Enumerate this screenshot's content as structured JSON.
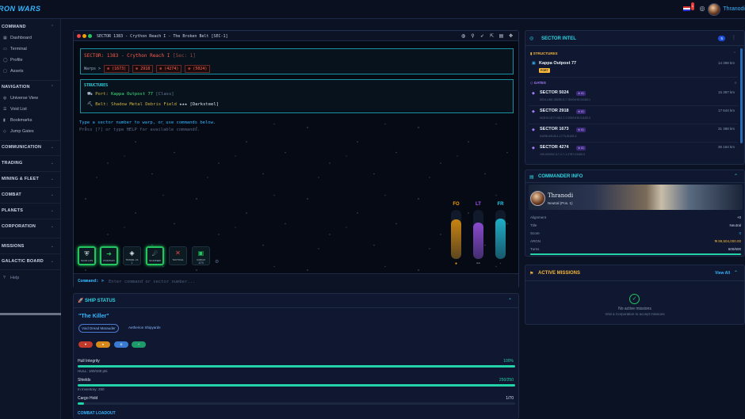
{
  "app": {
    "logo": "RON WARS",
    "username": "Thranodi",
    "notif_badge": "1"
  },
  "sidebar": {
    "sections": [
      {
        "label": "COMMAND",
        "items": [
          {
            "label": "Dashboard",
            "icon": "dashboard-icon"
          },
          {
            "label": "Terminal",
            "icon": "terminal-icon"
          },
          {
            "label": "Profile",
            "icon": "user-icon"
          },
          {
            "label": "Assets",
            "icon": "box-icon"
          }
        ]
      },
      {
        "label": "NAVIGATION",
        "items": [
          {
            "label": "Universe View",
            "icon": "globe-icon"
          },
          {
            "label": "Void List",
            "icon": "list-icon"
          },
          {
            "label": "Bookmarks",
            "icon": "bookmark-icon"
          },
          {
            "label": "Jump Gates",
            "icon": "gate-icon"
          }
        ]
      },
      {
        "label": "COMMUNICATION"
      },
      {
        "label": "TRADING"
      },
      {
        "label": "MINING & FLEET"
      },
      {
        "label": "COMBAT"
      },
      {
        "label": "PLANETS"
      },
      {
        "label": "CORPORATION"
      },
      {
        "label": "MISSIONS"
      },
      {
        "label": "GALACTIC BOARD"
      }
    ],
    "help": "Help"
  },
  "terminal": {
    "title": "SECTOR 1383 - Crython Reach I - The Broken Belt [SEC-1]",
    "sector_label": "SECTOR: 1383 - Crython Reach I",
    "sector_tag": "[Sec: 1]",
    "warps_label": "Warps >",
    "warps": [
      "(1673)",
      "2918",
      "(4274)",
      "(5024)"
    ],
    "structures_header": "STRUCTURES",
    "port_label": "Port:",
    "port_name": "Kappa Outpost 77",
    "port_class": "[Class]",
    "belt_label": "Belt:",
    "belt_name": "Shadow Metal Debris Field",
    "belt_stars": "★★★",
    "belt_type": "[Darksteel]",
    "hint1": "Type a sector number to warp, or use commands below.",
    "hint2": "Press [?] or type HELP for available commands.",
    "gauges": [
      {
        "label": "FO",
        "color": "#f59e0b",
        "level": 0.8
      },
      {
        "label": "LT",
        "color": "#a855f7",
        "level": 0.75
      },
      {
        "label": "FR",
        "color": "#22d3ee",
        "level": 0.82
      }
    ],
    "actions": [
      {
        "label": "SCAN LOS",
        "icon": "◉",
        "count": "",
        "on": true
      },
      {
        "label": "POSITION",
        "icon": "➜",
        "count": "",
        "on": true
      },
      {
        "label": "TRAVEL LS",
        "icon": "◈",
        "count": "1",
        "on": false
      },
      {
        "label": "SCANNER",
        "icon": "☄",
        "count": "",
        "on": true
      },
      {
        "label": "TACTICAL",
        "icon": "✕",
        "count": "",
        "on": false
      },
      {
        "label": "CARGO",
        "icon": "▣",
        "count": "1/70",
        "on": false
      }
    ],
    "cmd_label": "Command: >",
    "cmd_placeholder": "Enter command or sector number..."
  },
  "ship": {
    "header": "SHIP STATUS",
    "name": "\"The Killer\"",
    "tags": [
      "Void Dread Marauder",
      "Aetherion Shipyards"
    ],
    "hull_label": "Hull Integrity",
    "hull_pct": "100%",
    "hull_sub": "HULL: 100/100 pts",
    "hull_level": 1.0,
    "shields_label": "Shields",
    "shields_val": "250/250",
    "shields_sub": "In Inventory: 250",
    "shields_level": 1.0,
    "cargo_label": "Cargo Hold",
    "cargo_val": "1/70",
    "cargo_level": 0.014,
    "combat_label": "COMBAT LOADOUT"
  },
  "intel": {
    "header": "SECTOR INTEL",
    "count_badge": "5",
    "structures_label": "STRUCTURES",
    "outpost_name": "Kappa Outpost 77",
    "outpost_badge": "PORT",
    "outpost_dist": "14 398 km",
    "gates_label": "GATES",
    "gates_count": "4",
    "gates": [
      {
        "name": "SECTOR 5024",
        "badge": "★ 61",
        "dist": "15 397 km",
        "sub": "5024-LINE-08259-G-7 00001HS-01183-1"
      },
      {
        "name": "SECTOR 2918",
        "badge": "★ 61",
        "dist": "17 644 km",
        "sub": "N02HS-0277-NS1-7-2 00001HS-01183-3"
      },
      {
        "name": "SECTOR 1673",
        "badge": "★ 61",
        "dist": "31 398 km",
        "sub": "04298-00149-1-1773-01183-3"
      },
      {
        "name": "SECTOR 4274",
        "badge": "★ 61",
        "dist": "36 164 km",
        "sub": "199-002002-3-7-2-7-1-2787-01183-3"
      }
    ]
  },
  "commander": {
    "header": "COMMANDER INFO",
    "name": "Thranodi",
    "rank": "Neutral (Pos. 1)",
    "rows": [
      {
        "k": "Alignment",
        "v": "+0"
      },
      {
        "k": "Title",
        "v": "Neutral"
      },
      {
        "k": "Score",
        "v": "0"
      },
      {
        "k": "ARGN",
        "v": "₦ 99,504,000.00"
      },
      {
        "k": "Turns",
        "v": "600/600"
      }
    ],
    "turns_level": 1.0
  },
  "missions": {
    "header": "ACTIVE MISSIONS",
    "view_all": "View All",
    "empty": "No active missions",
    "hint": "Visit a Corporation to accept missions"
  },
  "colors": {
    "accent": "#35b6ff",
    "teal": "#2ed3e0",
    "success": "#22c55e",
    "danger": "#ff5a4a"
  }
}
